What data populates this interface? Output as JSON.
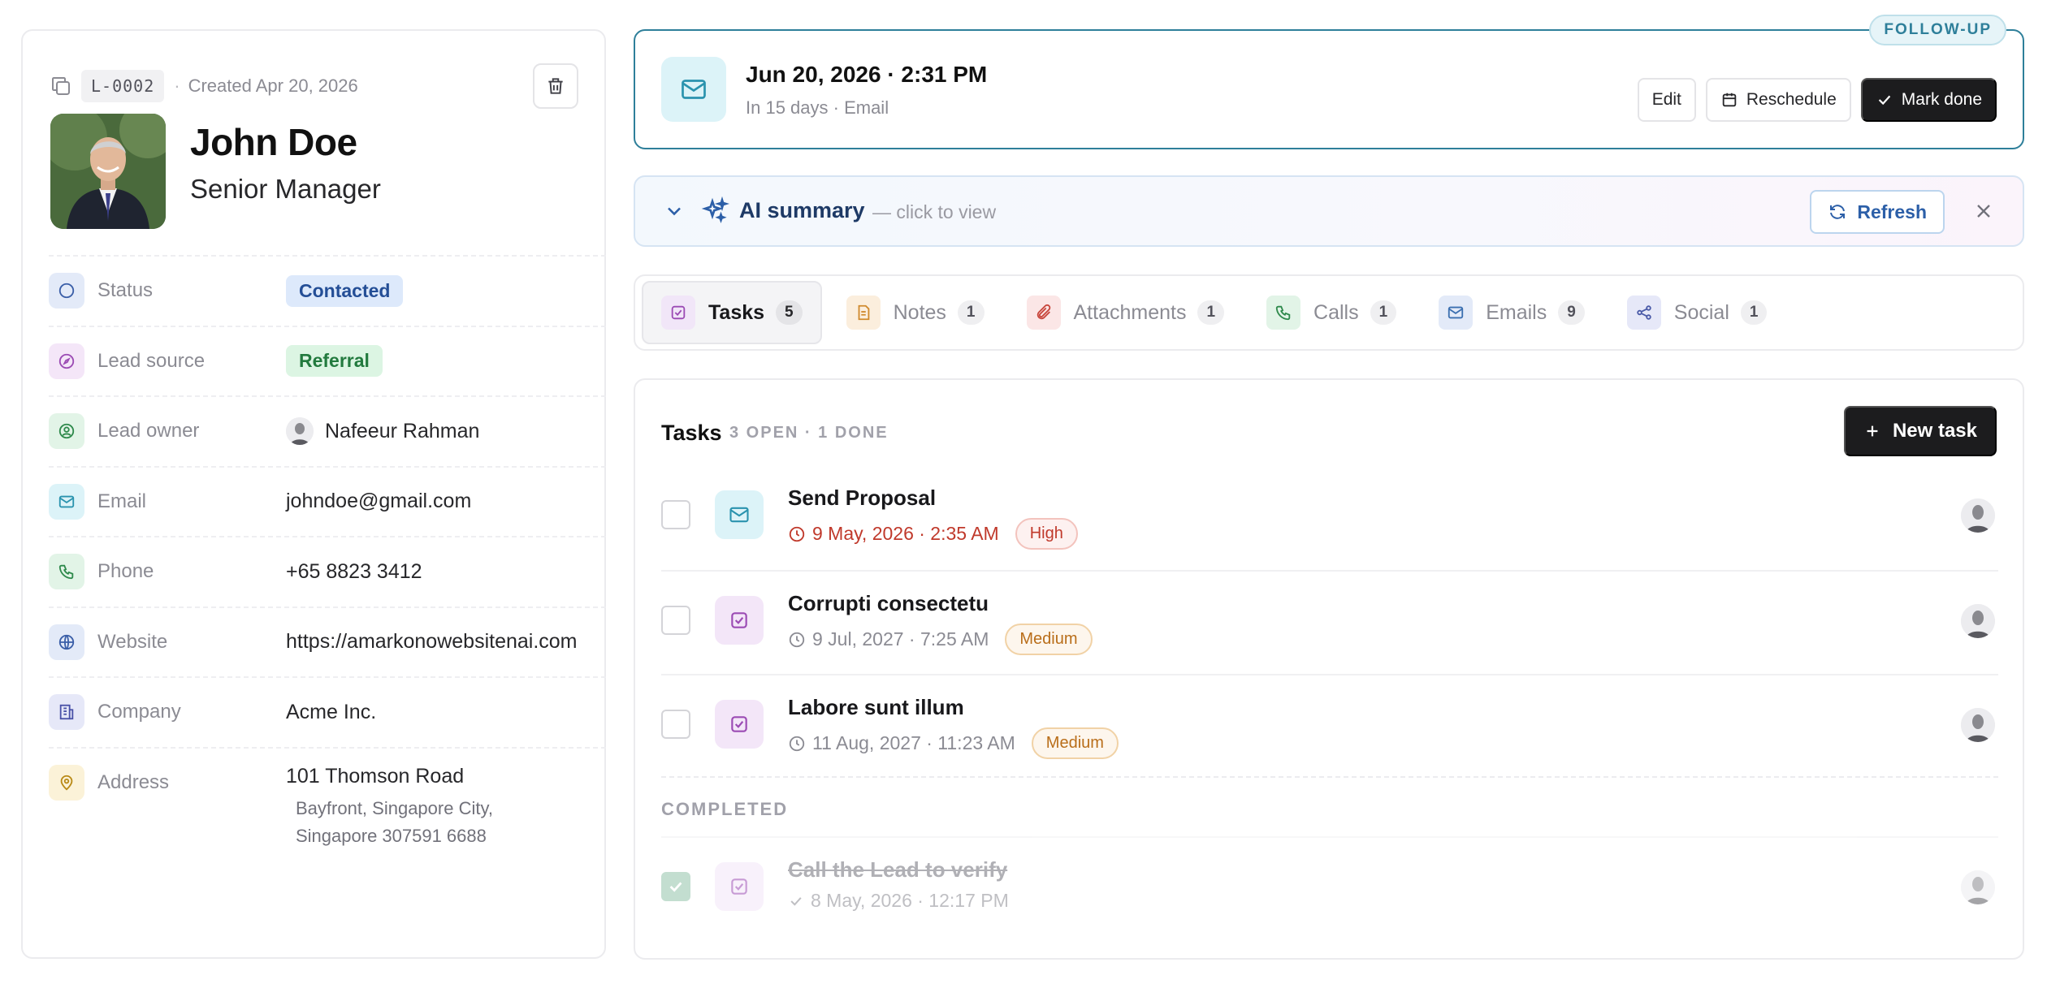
{
  "lead": {
    "id": "L-0002",
    "created": "Created Apr 20, 2026",
    "name": "John Doe",
    "job_title": "Senior Manager"
  },
  "fields": {
    "status": {
      "label": "Status",
      "value": "Contacted"
    },
    "lead_source": {
      "label": "Lead source",
      "value": "Referral"
    },
    "lead_owner": {
      "label": "Lead owner",
      "value": "Nafeeur Rahman"
    },
    "email": {
      "label": "Email",
      "value": "johndoe@gmail.com"
    },
    "phone": {
      "label": "Phone",
      "value": "+65 8823 3412"
    },
    "website": {
      "label": "Website",
      "value": "https://amarkonowebsitenai.com"
    },
    "company": {
      "label": "Company",
      "value": "Acme Inc."
    },
    "address": {
      "label": "Address",
      "line1": "101 Thomson Road",
      "line2": "Bayfront, Singapore City,",
      "line3": "Singapore 307591 6688"
    }
  },
  "followup": {
    "tag": "FOLLOW-UP",
    "datetime": "Jun 20, 2026 · 2:31 PM",
    "sub": "In 15 days · Email",
    "edit": "Edit",
    "reschedule": "Reschedule",
    "mark_done": "Mark done"
  },
  "ai_summary": {
    "title": "AI summary",
    "hint": "— click to view",
    "refresh": "Refresh"
  },
  "tabs": [
    {
      "label": "Tasks",
      "count": "5"
    },
    {
      "label": "Notes",
      "count": "1"
    },
    {
      "label": "Attachments",
      "count": "1"
    },
    {
      "label": "Calls",
      "count": "1"
    },
    {
      "label": "Emails",
      "count": "9"
    },
    {
      "label": "Social",
      "count": "1"
    }
  ],
  "tasks_panel": {
    "title": "Tasks",
    "meta": "3 OPEN · 1 DONE",
    "new_task": "New task",
    "completed_label": "COMPLETED",
    "open": [
      {
        "title": "Send Proposal",
        "due": "9 May, 2026 · 2:35 AM",
        "priority": "High",
        "type_icon": "mail-icon"
      },
      {
        "title": "Corrupti consectetu",
        "due": "9 Jul, 2027 · 7:25 AM",
        "priority": "Medium",
        "type_icon": "task-icon"
      },
      {
        "title": "Labore sunt illum",
        "due": "11 Aug, 2027 · 11:23 AM",
        "priority": "Medium",
        "type_icon": "task-icon"
      }
    ],
    "done": [
      {
        "title": "Call the Lead to verify",
        "completed": "8 May, 2026 · 12:17 PM",
        "type_icon": "task-icon"
      }
    ]
  },
  "colors": {
    "accent_teal": "#2e7f9a",
    "ai_blue": "#2c5fa8",
    "priority_high": "#c0392b",
    "priority_medium": "#b96e1a"
  }
}
